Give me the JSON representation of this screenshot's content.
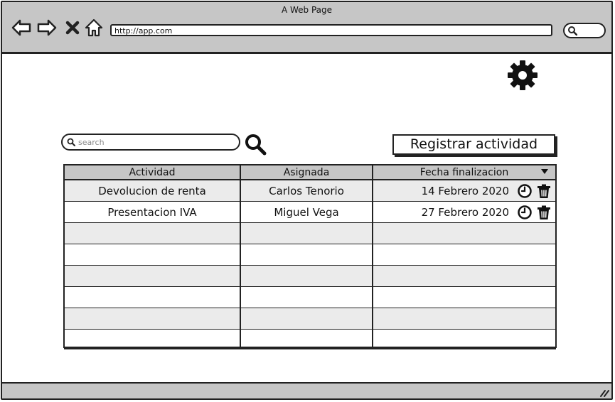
{
  "window": {
    "title": "A Web Page",
    "url": "http://app.com"
  },
  "page": {
    "search_placeholder": "search",
    "register_label": "Registrar actividad"
  },
  "table": {
    "columns": [
      "Actividad",
      "Asignada",
      "Fecha finalizacion"
    ],
    "rows": [
      {
        "actividad": "Devolucion de renta",
        "asignada": "Carlos Tenorio",
        "fecha": "14 Febrero 2020"
      },
      {
        "actividad": "Presentacion IVA",
        "asignada": "Miguel Vega",
        "fecha": "27 Febrero 2020"
      }
    ],
    "empty_row_count": 6
  },
  "icons": {
    "nav": [
      "back-icon",
      "forward-icon",
      "close-icon",
      "home-icon"
    ],
    "settings": "gear-icon",
    "search": "search-icon",
    "row_actions": [
      "clock-icon",
      "trash-icon"
    ],
    "sort": "sort-down-icon"
  },
  "colors": {
    "chrome": "#c6c6c6",
    "alt_row": "#ebebeb",
    "ink": "#222222"
  }
}
